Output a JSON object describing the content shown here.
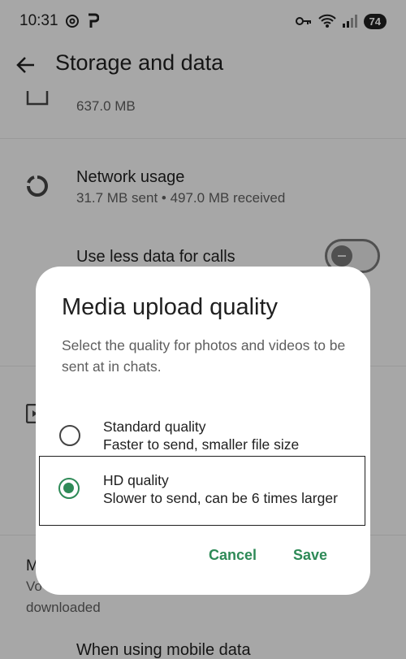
{
  "status_bar": {
    "time": "10:31",
    "battery": "74"
  },
  "app_bar": {
    "title": "Storage and data"
  },
  "settings": {
    "storage_size": "637.0 MB",
    "network_usage_title": "Network usage",
    "network_usage_sub": "31.7 MB sent • 497.0 MB received",
    "calls_title": "Use less data for calls",
    "auto_download_partial_1": "M",
    "auto_download_partial_2": "Vo",
    "auto_download_sub": "downloaded",
    "mobile_data_title": "When using mobile data"
  },
  "dialog": {
    "title": "Media upload quality",
    "description": "Select the quality for photos and videos to be sent at in chats.",
    "options": [
      {
        "title": "Standard quality",
        "subtitle": "Faster to send, smaller file size",
        "selected": false
      },
      {
        "title": "HD quality",
        "subtitle": "Slower to send, can be 6 times larger",
        "selected": true
      }
    ],
    "cancel_label": "Cancel",
    "save_label": "Save"
  },
  "colors": {
    "accent": "#2e8a57",
    "scrim": "rgba(0,0,0,0.32)"
  },
  "icons": {
    "back": "arrow-left-icon",
    "network": "data-usage-icon",
    "storage": "storage-icon",
    "media": "media-icon"
  }
}
